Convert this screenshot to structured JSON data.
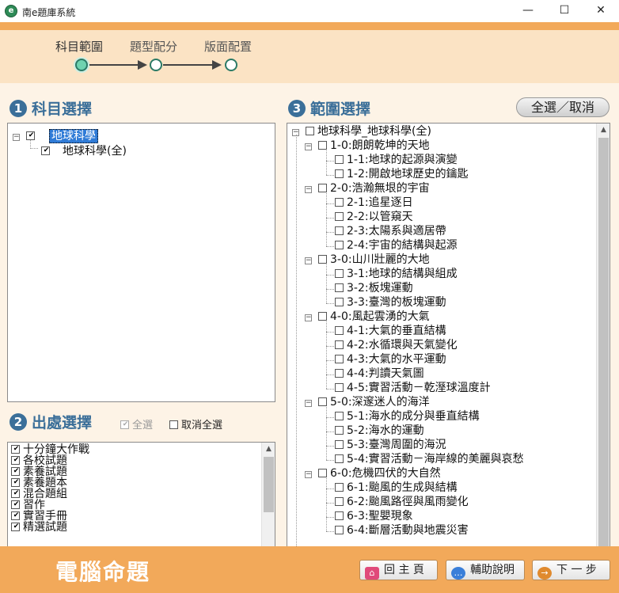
{
  "window": {
    "title": "南e題庫系統",
    "icon_text": "e",
    "minimize": "—",
    "maximize": "☐",
    "close": "✕"
  },
  "steps": [
    {
      "label": "科目範圍",
      "active": true
    },
    {
      "label": "題型配分",
      "active": false
    },
    {
      "label": "版面配置",
      "active": false
    }
  ],
  "sections": {
    "subject": {
      "num": "1",
      "title": "科目選擇"
    },
    "source": {
      "num": "2",
      "title": "出處選擇",
      "select_all": "全選",
      "cancel_all": "取消全選"
    },
    "scope": {
      "num": "3",
      "title": "範圍選擇",
      "select_all_button": "全選／取消"
    }
  },
  "subject_tree": {
    "root": "地球科學",
    "child": "地球科學(全)"
  },
  "source_items": [
    "十分鐘大作戰",
    "各校試題",
    "素養試題",
    "素養題本",
    "混合題組",
    "習作",
    "實習手冊",
    "精選試題"
  ],
  "scope_tree": {
    "root": "地球科學_地球科學(全)",
    "chapters": [
      {
        "label": "1-0:朗朗乾坤的天地",
        "items": [
          "1-1:地球的起源與演變",
          "1-2:開啟地球歷史的鑰匙"
        ]
      },
      {
        "label": "2-0:浩瀚無垠的宇宙",
        "items": [
          "2-1:追星逐日",
          "2-2:以管窺天",
          "2-3:太陽系與適居帶",
          "2-4:宇宙的結構與起源"
        ]
      },
      {
        "label": "3-0:山川壯麗的大地",
        "items": [
          "3-1:地球的結構與組成",
          "3-2:板塊運動",
          "3-3:臺灣的板塊運動"
        ]
      },
      {
        "label": "4-0:風起雲湧的大氣",
        "items": [
          "4-1:大氣的垂直結構",
          "4-2:水循環與天氣變化",
          "4-3:大氣的水平運動",
          "4-4:判讀天氣圖",
          "4-5:實習活動－乾溼球溫度計"
        ]
      },
      {
        "label": "5-0:深邃迷人的海洋",
        "items": [
          "5-1:海水的成分與垂直結構",
          "5-2:海水的運動",
          "5-3:臺灣周圍的海況",
          "5-4:實習活動－海岸線的美麗與哀愁"
        ]
      },
      {
        "label": "6-0:危機四伏的大自然",
        "items": [
          "6-1:颱風的生成與結構",
          "6-2:颱風路徑與風雨變化",
          "6-3:聖嬰現象",
          "6-4:斷層活動與地震災害"
        ]
      }
    ]
  },
  "bottom": {
    "brand": "電腦命題",
    "home": "回 主 頁",
    "help": "輔助說明",
    "next": "下 一 步",
    "home_icon": "⌂",
    "help_icon": "…",
    "next_icon": "→"
  },
  "colors": {
    "accent_orange": "#f2a95a",
    "title_blue": "#3b6f99",
    "step_teal": "#2b7a66",
    "beige": "#fdf3e6"
  }
}
